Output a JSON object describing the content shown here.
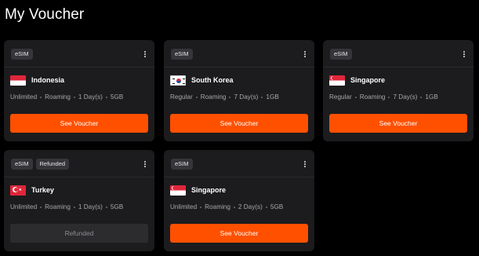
{
  "page": {
    "title": "My Voucher"
  },
  "colors": {
    "accent": "#ff5000",
    "card_bg": "#1c1c1e",
    "page_bg": "#000000"
  },
  "vouchers": [
    {
      "badges": [
        "eSIM"
      ],
      "country": "Indonesia",
      "flag_icon": "indonesia-flag-icon",
      "specs": [
        "Unlimited",
        "Roaming",
        "1 Day(s)",
        "5GB"
      ],
      "button_label": "See Voucher",
      "button_state": "active"
    },
    {
      "badges": [
        "eSIM"
      ],
      "country": "South Korea",
      "flag_icon": "south-korea-flag-icon",
      "specs": [
        "Regular",
        "Roaming",
        "7 Day(s)",
        "1GB"
      ],
      "button_label": "See Voucher",
      "button_state": "active"
    },
    {
      "badges": [
        "eSIM"
      ],
      "country": "Singapore",
      "flag_icon": "singapore-flag-icon",
      "specs": [
        "Regular",
        "Roaming",
        "7 Day(s)",
        "1GB"
      ],
      "button_label": "See Voucher",
      "button_state": "active"
    },
    {
      "badges": [
        "eSIM",
        "Refunded"
      ],
      "country": "Turkey",
      "flag_icon": "turkey-flag-icon",
      "specs": [
        "Unlimited",
        "Roaming",
        "1 Day(s)",
        "5GB"
      ],
      "button_label": "Refunded",
      "button_state": "disabled"
    },
    {
      "badges": [
        "eSIM"
      ],
      "country": "Singapore",
      "flag_icon": "singapore-flag-icon",
      "specs": [
        "Unlimited",
        "Roaming",
        "2 Day(s)",
        "5GB"
      ],
      "button_label": "See Voucher",
      "button_state": "active"
    }
  ]
}
